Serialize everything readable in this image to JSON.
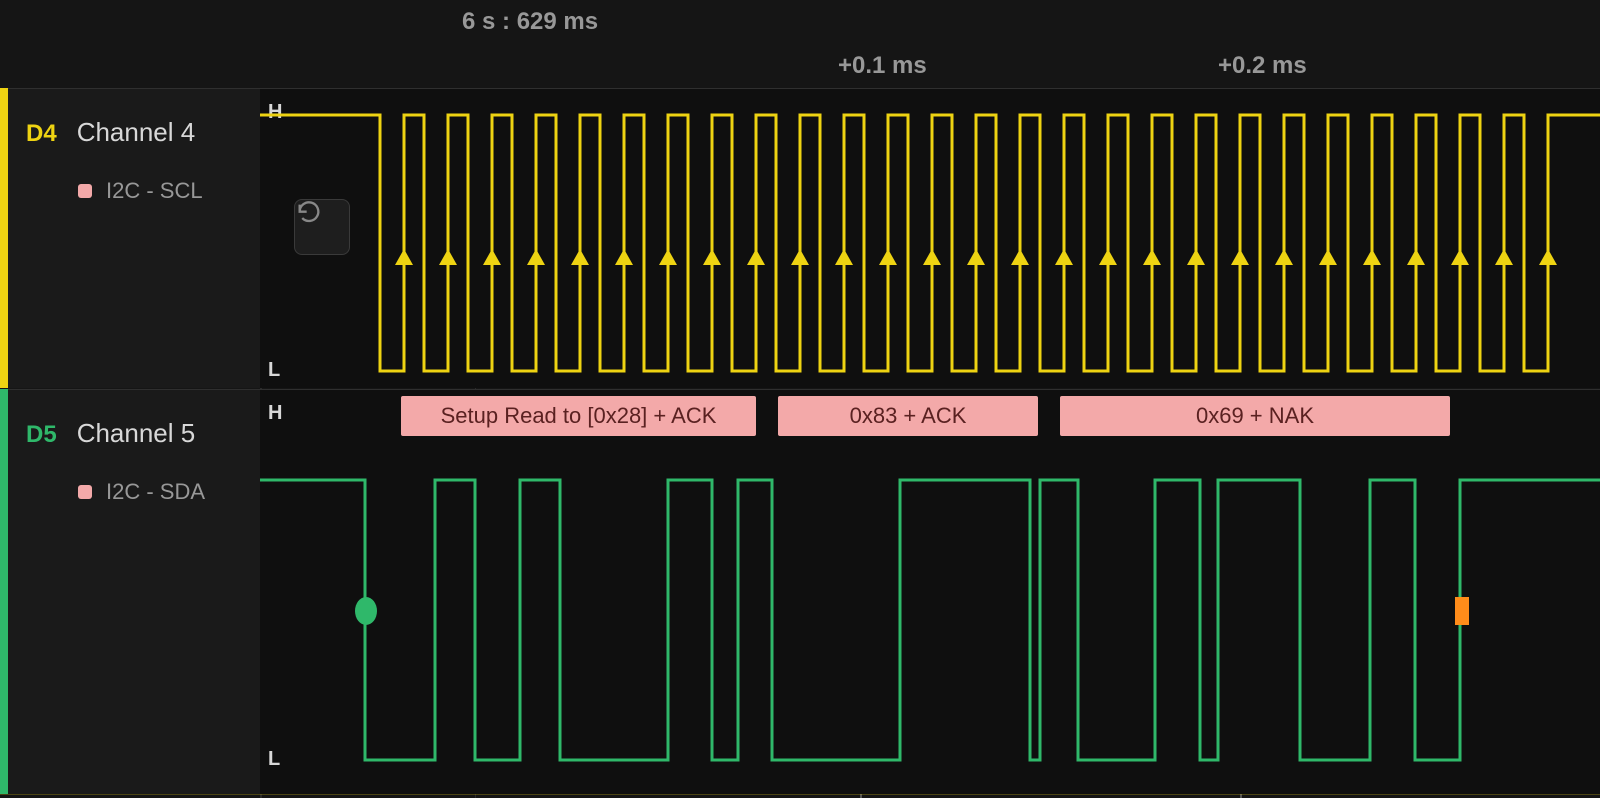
{
  "ruler": {
    "main_time": "6 s : 629 ms",
    "ticks": [
      "+0.1 ms",
      "+0.2 ms"
    ]
  },
  "channels": [
    {
      "id": "D4",
      "name": "Channel 4",
      "protocol": "I2C - SCL",
      "color": "#eed312",
      "levels": {
        "high": "H",
        "low": "L"
      },
      "waveform_note": "SCL clock line: idle high, 27 clock pulses with rising-edge sample arrows"
    },
    {
      "id": "D5",
      "name": "Channel 5",
      "protocol": "I2C - SDA",
      "color": "#2fb86a",
      "levels": {
        "high": "H",
        "low": "L"
      },
      "waveform_note": "SDA data line with start condition (green dot) and stop condition (orange square)"
    }
  ],
  "decode_labels": [
    {
      "text": "Setup Read to [0x28] + ACK"
    },
    {
      "text": "0x83 + ACK"
    },
    {
      "text": "0x69 + NAK"
    }
  ],
  "i2c_transaction": {
    "address": "0x28",
    "operation": "Read",
    "bytes": [
      {
        "value": "0x83",
        "ack": "ACK"
      },
      {
        "value": "0x69",
        "ack": "NAK"
      }
    ]
  },
  "icons": {
    "reset_zoom": "reset-zoom"
  }
}
